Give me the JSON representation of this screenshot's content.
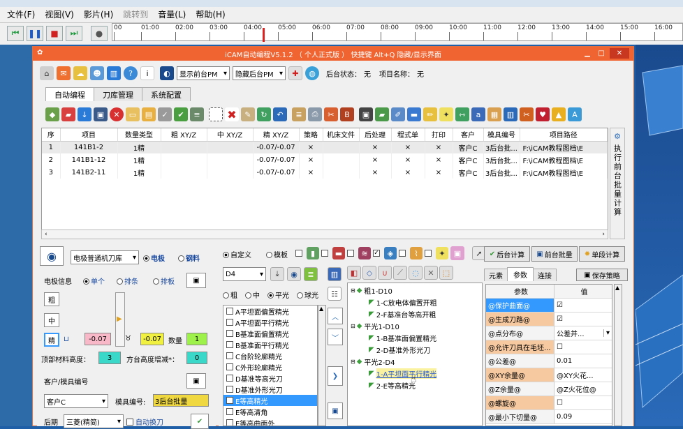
{
  "player": {
    "menu": [
      "文件(F)",
      "视图(V)",
      "影片(H)",
      "跳转到",
      "音量(L)",
      "帮助(H)"
    ],
    "timeline_ticks": [
      "00",
      "01:00",
      "02:00",
      "03:00",
      "04:00",
      "05:00",
      "06:00",
      "07:00",
      "08:00",
      "09:00",
      "10:00",
      "11:00",
      "12:00",
      "13:00",
      "14:00",
      "15:00",
      "16:00"
    ]
  },
  "dialog": {
    "title": "iCAM自动编程V5.1.2 （ 个人正式版 ）     快捷键 Alt+Q 隐藏/显示界面",
    "show_pm": "显示前台PM",
    "hide_pm": "隐藏后台PM",
    "bg_status_label": "后台状态：",
    "bg_status_value": "无",
    "project_label": "项目名称：",
    "project_value": "无",
    "tabs": [
      "自动编程",
      "刀库管理",
      "系统配置"
    ]
  },
  "grid": {
    "headers": [
      "序",
      "项目",
      "数量类型",
      "粗 XY/Z",
      "中 XY/Z",
      "精 XY/Z",
      "策略",
      "机床文件",
      "后处理",
      "程式单",
      "打印",
      "客户",
      "模具编号",
      "项目路径"
    ],
    "rows": [
      [
        "1",
        "141B1-2",
        "1精",
        "",
        "",
        "-0.07/-0.07",
        "×",
        "",
        "×",
        "×",
        "×",
        "客户C",
        "3后台批...",
        "F:\\iCAM教程图档\\E"
      ],
      [
        "2",
        "141B1-12",
        "1精",
        "",
        "",
        "-0.07/-0.07",
        "×",
        "",
        "×",
        "×",
        "×",
        "客户C",
        "3后台批...",
        "F:\\iCAM教程图档\\E"
      ],
      [
        "3",
        "141B2-11",
        "1精",
        "",
        "",
        "-0.07/-0.07",
        "×",
        "",
        "×",
        "×",
        "×",
        "客户C",
        "3后台批...",
        "F:\\iCAM教程图档\\E"
      ]
    ],
    "side_button": "执行前台批量计算"
  },
  "left": {
    "tool_library": "电极普通机刀库",
    "radio_electrode": "电极",
    "radio_steel": "钢料",
    "electrode_info": "电极信息",
    "r_single": "单个",
    "r_row": "排条",
    "r_board": "排板",
    "btn_rough": "粗",
    "btn_mid": "中",
    "btn_fine": "精",
    "spark1": "-0.07",
    "spark2": "-0.07",
    "qty_label": "数量",
    "qty": "1",
    "top_height_label": "顶部材料高度：",
    "top_height": "3",
    "square_label": "方台高度增减*：",
    "square": "0",
    "customer_label": "客户/模具编号",
    "customer": "客户C",
    "mold_label": "模具编号:",
    "mold": "3后台批量",
    "post_label": "后期",
    "post": "三菱(精简)",
    "auto_tool": "自动换刀"
  },
  "middle": {
    "r_custom": "自定义",
    "r_template": "模板",
    "tool": "D4",
    "r_rough": "粗",
    "r_mid": "中",
    "r_flat": "平光",
    "r_ball": "球光",
    "strategies": [
      "A平坦面偏置精光",
      "A平坦面平行精光",
      "B基准面偏置精光",
      "B基准面平行精光",
      "C台阶轮廓精光",
      "C外形轮廓精光",
      "D基准等高光刀",
      "D基准外形光刀",
      "E等高精光",
      "E等高清角",
      "E等高曲面外"
    ],
    "selected_strategy": "E等高精光"
  },
  "tree": {
    "nodes": [
      {
        "label": "粗1-D10",
        "level": 0
      },
      {
        "label": "1-C放电体偏置开粗",
        "level": 1
      },
      {
        "label": "2-F基准台等高开粗",
        "level": 1
      },
      {
        "label": "平光1-D10",
        "level": 0
      },
      {
        "label": "1-B基准面偏置精光",
        "level": 1
      },
      {
        "label": "2-D基准外形光刀",
        "level": 1
      },
      {
        "label": "平光2-D4",
        "level": 0
      },
      {
        "label": "1-A平坦面平行精光",
        "level": 1
      },
      {
        "label": "2-E等高精光",
        "level": 1
      }
    ]
  },
  "right": {
    "bg_calc": "后台计算",
    "fg_batch": "前台批量",
    "single_calc": "单段计算",
    "tabs": [
      "元素",
      "参数",
      "连接"
    ],
    "save_strategy": "保存策略",
    "param_header": "参数",
    "value_header": "值",
    "params": [
      {
        "k": "@保护曲面@",
        "v": "☑",
        "style": "blue"
      },
      {
        "k": "@生成刀路@",
        "v": "☑",
        "style": "peach"
      },
      {
        "k": "@点分布@",
        "v": "公差并...",
        "style": "plain"
      },
      {
        "k": "@允许刀具在毛坯...",
        "v": "☐",
        "style": "peach"
      },
      {
        "k": "@公差@",
        "v": "0.01",
        "style": "plain"
      },
      {
        "k": "@XY余量@",
        "v": "@XY火花...",
        "style": "peach"
      },
      {
        "k": "@Z余量@",
        "v": "@Z火花位@",
        "style": "plain"
      },
      {
        "k": "@螺旋@",
        "v": "☐",
        "style": "peach"
      },
      {
        "k": "@最小下切量@",
        "v": "0.09",
        "style": "plain"
      }
    ]
  }
}
